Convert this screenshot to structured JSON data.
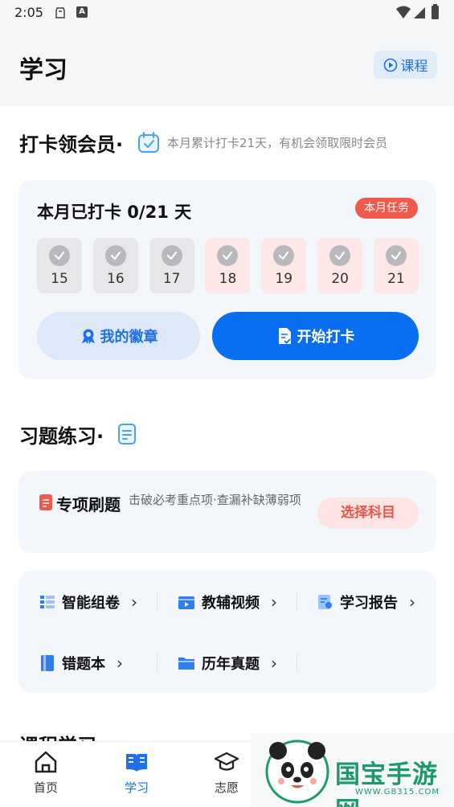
{
  "status_bar": {
    "time": "2:05",
    "a_icon": "A"
  },
  "header": {
    "title": "学习",
    "course_button": "课程"
  },
  "checkin_section": {
    "title": "打卡领会员·",
    "hint": "本月累计打卡21天，有机会领取限时会员",
    "status_text": "本月已打卡 0/21 天",
    "task_badge": "本月任务",
    "days": [
      {
        "num": "15",
        "state": "past"
      },
      {
        "num": "16",
        "state": "past"
      },
      {
        "num": "17",
        "state": "past"
      },
      {
        "num": "18",
        "state": "future"
      },
      {
        "num": "19",
        "state": "future"
      },
      {
        "num": "20",
        "state": "future"
      },
      {
        "num": "21",
        "state": "future"
      }
    ],
    "badge_button": "我的徽章",
    "start_button": "开始打卡"
  },
  "practice_section": {
    "title": "习题练习·",
    "special_title": "专项刷题",
    "special_desc": "击破必考重点项·查漏补缺薄弱项",
    "choose_button": "选择科目",
    "tools": [
      "智能组卷",
      "教辅视频",
      "学习报告",
      "错题本",
      "历年真题"
    ]
  },
  "next_section": {
    "title": "课程学习"
  },
  "bottom_nav": [
    "首页",
    "学习",
    "志愿"
  ],
  "colors": {
    "accent": "#0a6ef0",
    "danger": "#ef5a4c"
  },
  "watermark": {
    "text": "国宝手游网",
    "sub": "WWW.GB315.COM"
  }
}
